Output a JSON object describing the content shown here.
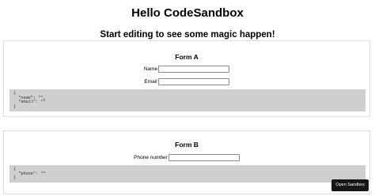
{
  "header": {
    "title": "Hello CodeSandbox",
    "subtitle": "Start editing to see some magic happen!"
  },
  "form_a": {
    "title": "Form A",
    "name_label": "Name",
    "name_value": "",
    "email_label": "Email",
    "email_value": "",
    "json_output": "{\n  \"name\": \"\",\n  \"email\": \"\"\n}"
  },
  "form_b": {
    "title": "Form B",
    "phone_label": "Phone number",
    "phone_value": "",
    "json_output": "{\n  \"phone\": \"\"\n}"
  },
  "sandbox": {
    "open_label": "Open Sandbox"
  }
}
